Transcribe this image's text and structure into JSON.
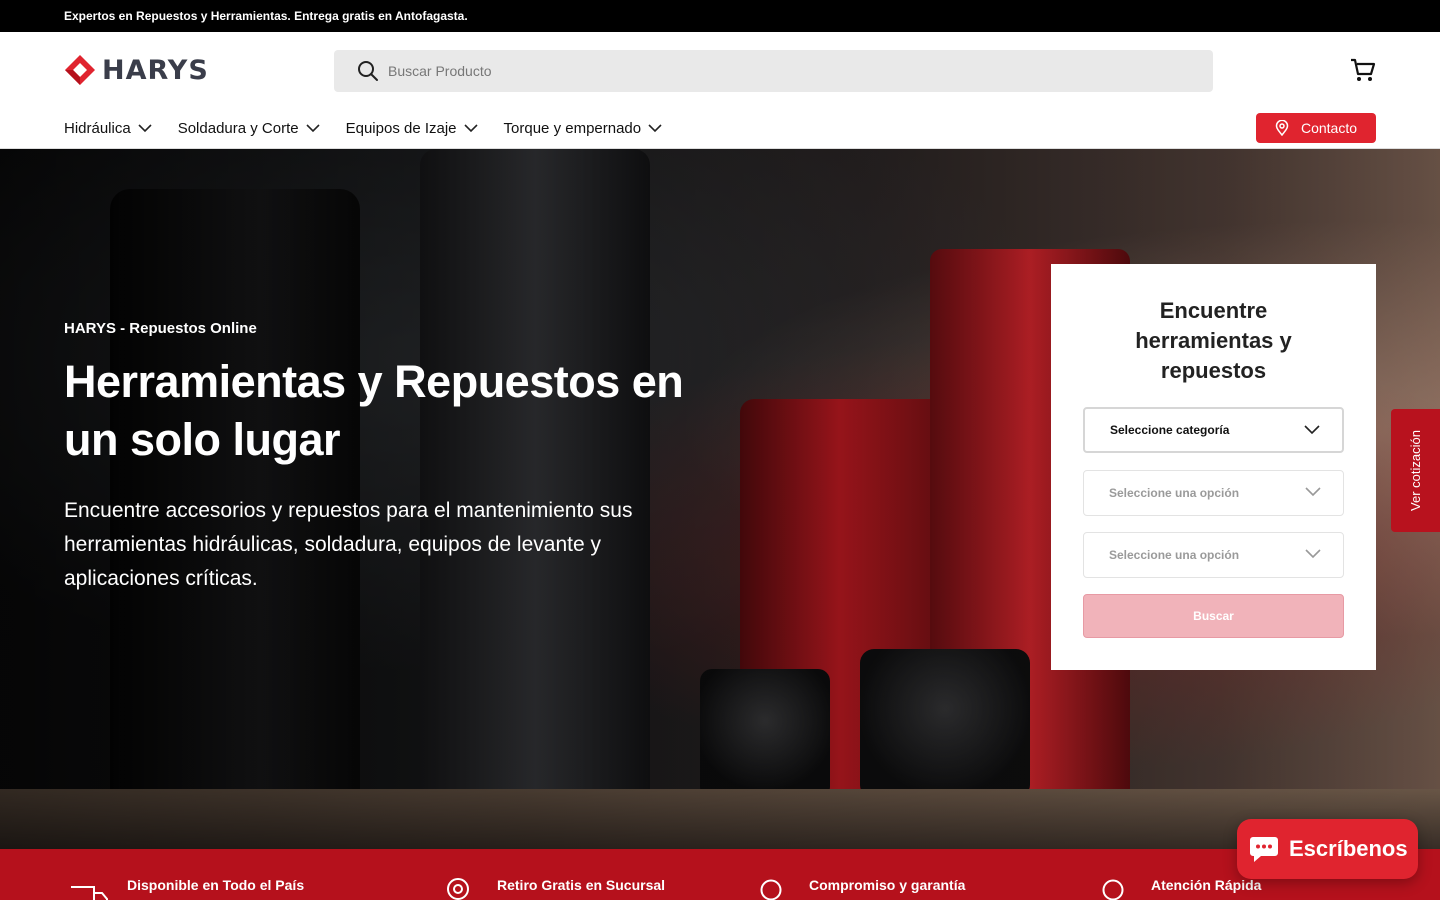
{
  "announcement": {
    "text": "Expertos en Repuestos y Herramientas. Entrega gratis en Antofagasta."
  },
  "header": {
    "logo_text": "HARYS",
    "search_placeholder": "Buscar Producto",
    "cart_icon": "cart-icon",
    "nav": [
      {
        "label": "Hidráulica"
      },
      {
        "label": "Soldadura y Corte"
      },
      {
        "label": "Equipos de Izaje"
      },
      {
        "label": "Torque y empernado"
      }
    ],
    "contact_label": "Contacto"
  },
  "hero": {
    "eyebrow": "HARYS - Repuestos Online",
    "title": "Herramientas y Repuestos en un solo lugar",
    "description": "Encuentre accesorios y repuestos para el mantenimiento sus herramientas hidráulicas, soldadura, equipos de levante y aplicaciones críticas."
  },
  "finder": {
    "title": "Encuentre herramientas y repuestos",
    "select_category": "Seleccione categoría",
    "select_option_1": "Seleccione una opción",
    "select_option_2": "Seleccione una opción",
    "button": "Buscar"
  },
  "side_tab": {
    "label": "Ver cotización"
  },
  "features": [
    {
      "label": "Disponible en Todo el País",
      "icon": "truck-icon"
    },
    {
      "label": "Retiro Gratis en Sucursal",
      "icon": "location-pin-icon"
    },
    {
      "label": "Compromiso y garantía",
      "icon": "check-circle-icon"
    },
    {
      "label": "Atención Rápida",
      "icon": "clock-icon"
    }
  ],
  "chat": {
    "label": "Escríbenos"
  },
  "colors": {
    "brand_red": "#e0242f",
    "dark_red": "#b5111c",
    "black": "#000000"
  }
}
